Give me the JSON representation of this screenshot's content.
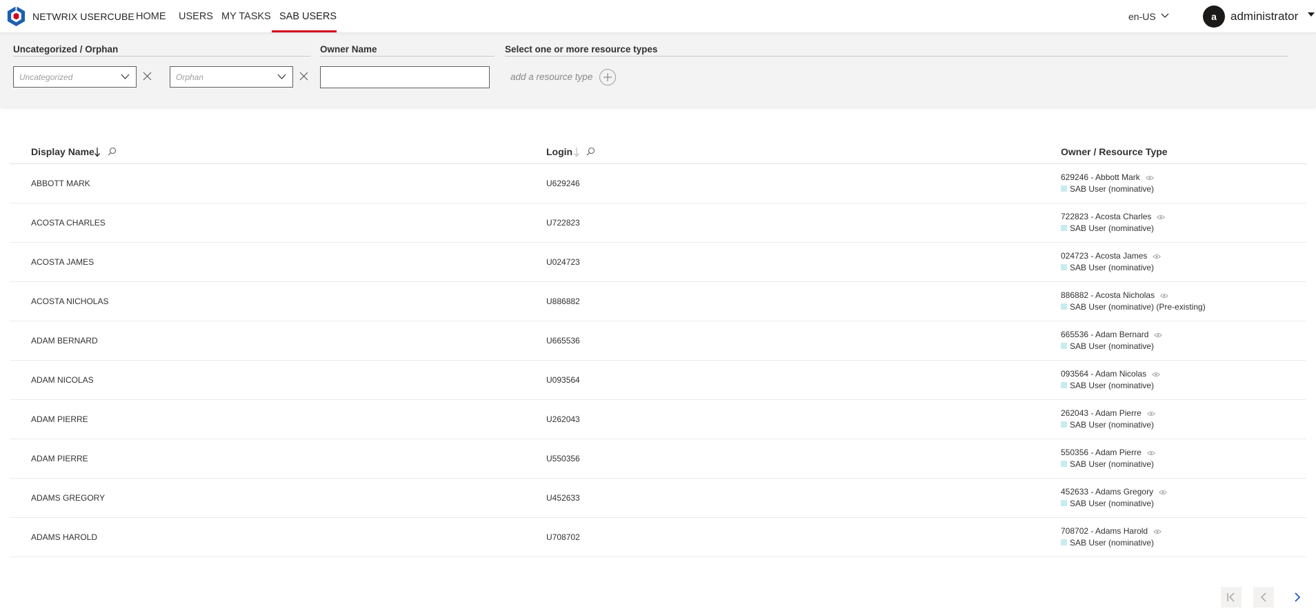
{
  "app": {
    "brand": "NETWRIX USERCUBE",
    "nav": [
      {
        "label": "HOME"
      },
      {
        "label": "USERS"
      },
      {
        "label": "MY TASKS"
      },
      {
        "label": "SAB USERS"
      }
    ],
    "active_nav": "SAB USERS",
    "language": "en-US",
    "user": {
      "initial": "a",
      "name": "administrator"
    }
  },
  "filters": {
    "category_label": "Uncategorized / Orphan",
    "category_placeholder": "Uncategorized",
    "orphan_placeholder": "Orphan",
    "owner_label": "Owner Name",
    "owner_value": "",
    "resource_types_label": "Select one or more resource types",
    "add_resource_type": "add a resource type"
  },
  "table": {
    "columns": [
      {
        "label": "Display Name",
        "sort": "descending",
        "searchable": true
      },
      {
        "label": "Login",
        "sort": "none",
        "searchable": true
      },
      {
        "label": "Owner / Resource Type",
        "sort": "none",
        "searchable": false
      }
    ],
    "rows": [
      {
        "display_name": "ABBOTT MARK",
        "login": "U629246",
        "owner": "629246 - Abbott Mark",
        "resource_type": "SAB User (nominative)"
      },
      {
        "display_name": "ACOSTA CHARLES",
        "login": "U722823",
        "owner": "722823 - Acosta Charles",
        "resource_type": "SAB User (nominative)"
      },
      {
        "display_name": "ACOSTA JAMES",
        "login": "U024723",
        "owner": "024723 - Acosta James",
        "resource_type": "SAB User (nominative)"
      },
      {
        "display_name": "ACOSTA NICHOLAS",
        "login": "U886882",
        "owner": "886882 - Acosta Nicholas",
        "resource_type": "SAB User (nominative) (Pre-existing)"
      },
      {
        "display_name": "ADAM BERNARD",
        "login": "U665536",
        "owner": "665536 - Adam Bernard",
        "resource_type": "SAB User (nominative)"
      },
      {
        "display_name": "ADAM NICOLAS",
        "login": "U093564",
        "owner": "093564 - Adam Nicolas",
        "resource_type": "SAB User (nominative)"
      },
      {
        "display_name": "ADAM PIERRE",
        "login": "U262043",
        "owner": "262043 - Adam Pierre",
        "resource_type": "SAB User (nominative)"
      },
      {
        "display_name": "ADAM PIERRE",
        "login": "U550356",
        "owner": "550356 - Adam Pierre",
        "resource_type": "SAB User (nominative)"
      },
      {
        "display_name": "ADAMS GREGORY",
        "login": "U452633",
        "owner": "452633 - Adams Gregory",
        "resource_type": "SAB User (nominative)"
      },
      {
        "display_name": "ADAMS HAROLD",
        "login": "U708702",
        "owner": "708702 - Adams Harold",
        "resource_type": "SAB User (nominative)"
      }
    ]
  },
  "pager": {
    "first_enabled": false,
    "prev_enabled": false,
    "next_enabled": true
  },
  "colors": {
    "accent": "#d0021b",
    "logo_blue": "#1d5fb0",
    "resource_type_swatch": "#c7ecef"
  },
  "icons": [
    "logo-icon",
    "chevron-down-icon",
    "caret-down-icon",
    "close-icon",
    "plus-icon",
    "sort-arrow-icon",
    "search-icon",
    "eye-icon",
    "first-page-icon",
    "prev-page-icon",
    "next-page-icon"
  ]
}
